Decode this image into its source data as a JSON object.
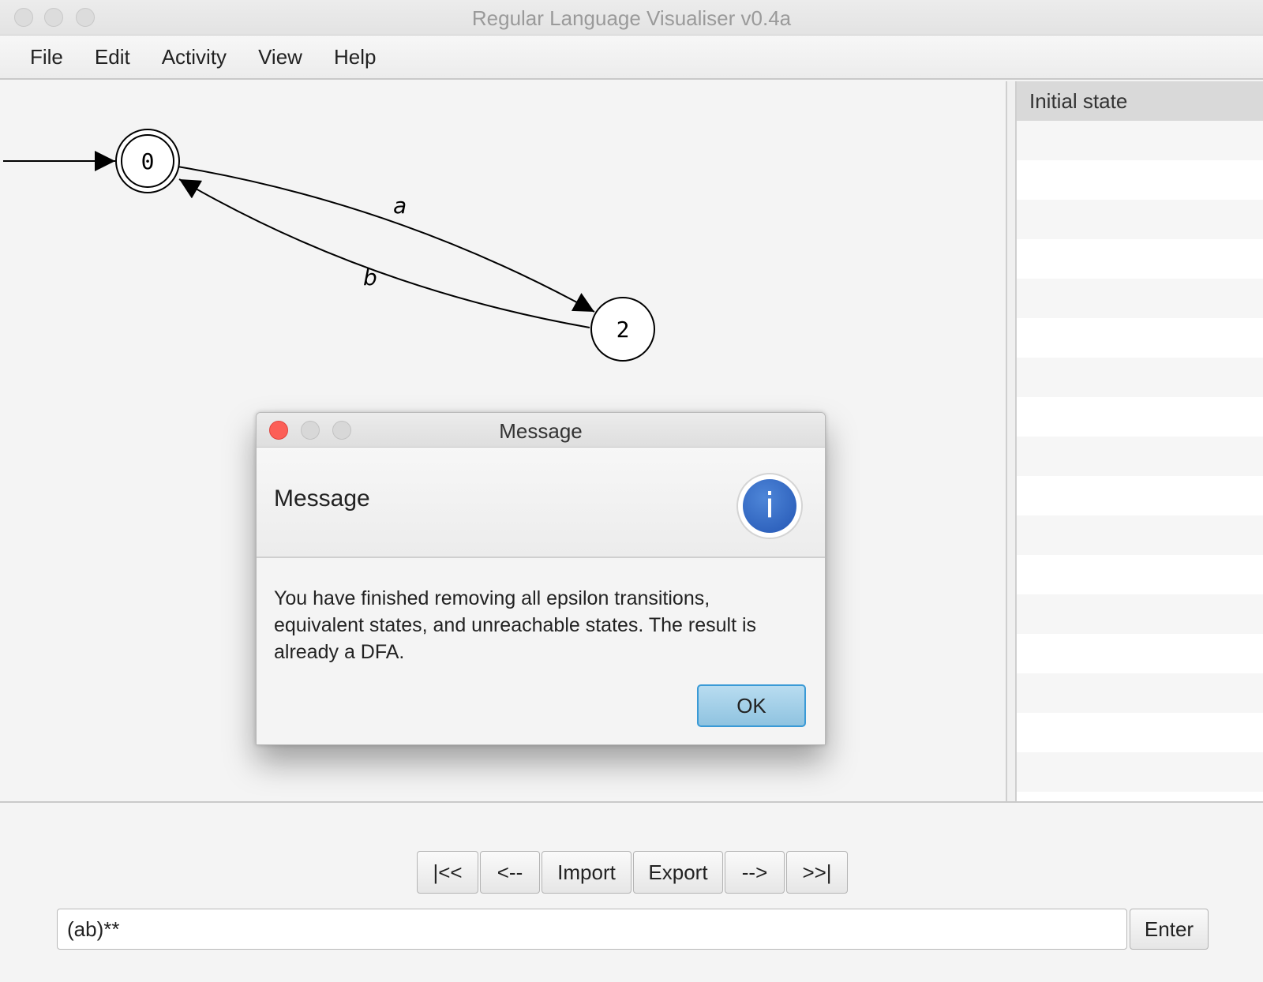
{
  "window": {
    "title": "Regular Language Visualiser v0.4a"
  },
  "menu": [
    "File",
    "Edit",
    "Activity",
    "View",
    "Help"
  ],
  "side_panel": {
    "header": "Initial state"
  },
  "automaton": {
    "states": [
      "0",
      "2"
    ],
    "initial_state": "0",
    "accepting_states": [
      "0"
    ],
    "transitions": [
      {
        "from": "0",
        "to": "2",
        "label": "a"
      },
      {
        "from": "2",
        "to": "0",
        "label": "b"
      }
    ]
  },
  "nav": {
    "first": "|<<",
    "prev": "<--",
    "import": "Import",
    "export": "Export",
    "next": "-->",
    "last": ">>|"
  },
  "regex_input": {
    "value": "(ab)**"
  },
  "enter_label": "Enter",
  "dialog": {
    "title": "Message",
    "heading": "Message",
    "icon": "info-icon",
    "body": "You have finished removing all epsilon transitions, equivalent states, and unreachable states. The result is already a DFA.",
    "ok_label": "OK"
  }
}
